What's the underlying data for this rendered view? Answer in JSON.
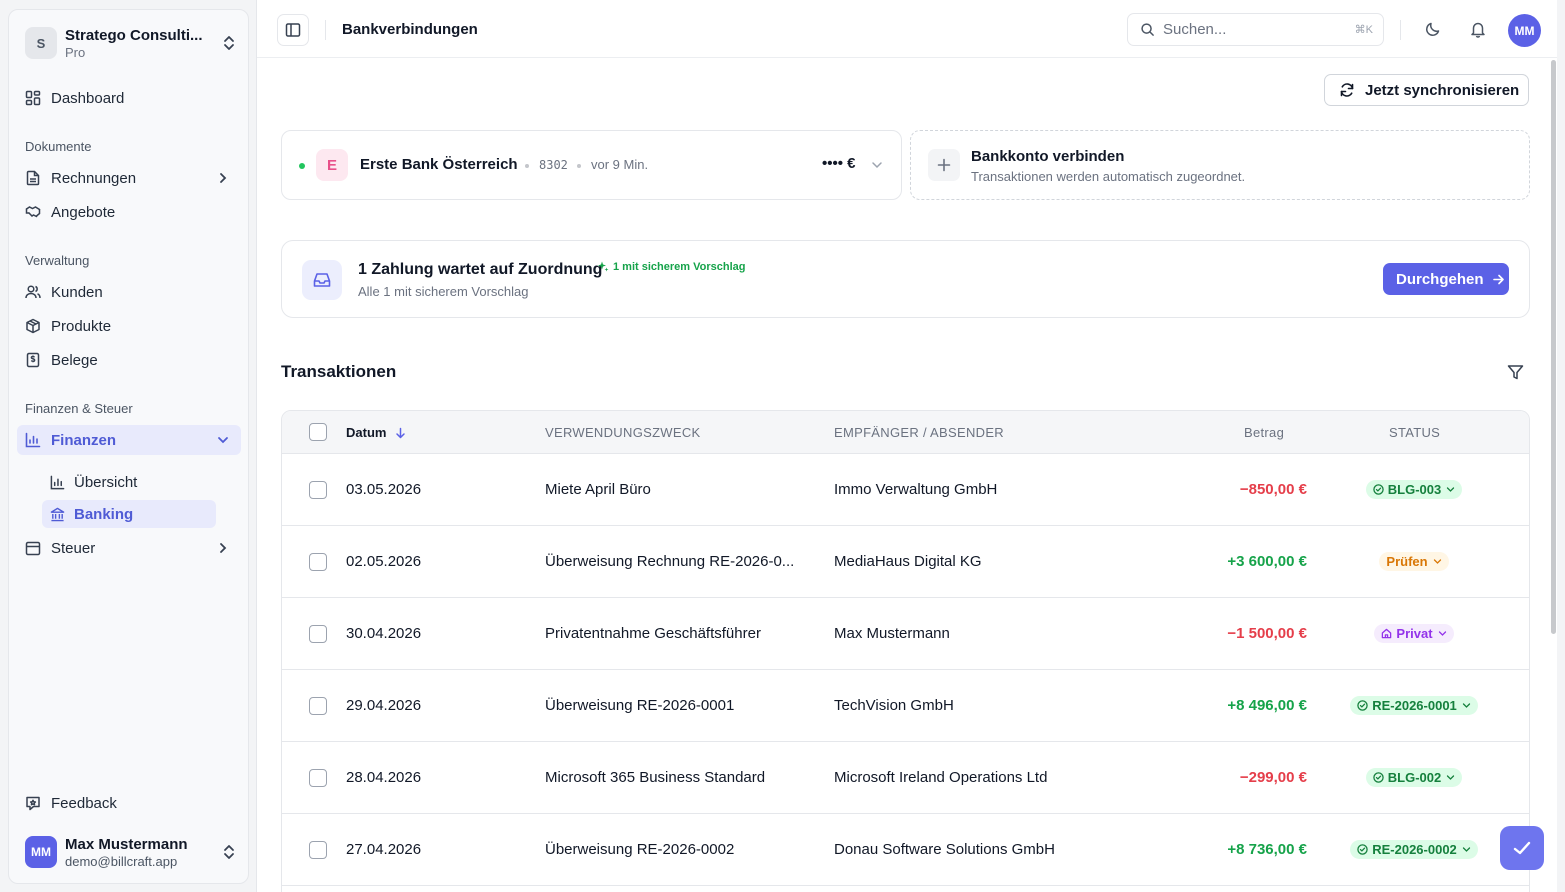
{
  "sidebar": {
    "org": {
      "initial": "S",
      "name": "Stratego Consulti...",
      "plan": "Pro"
    },
    "dashboard": "Dashboard",
    "sections": {
      "documents": "Dokumente",
      "admin": "Verwaltung",
      "finance": "Finanzen & Steuer"
    },
    "items": {
      "invoices": "Rechnungen",
      "offers": "Angebote",
      "customers": "Kunden",
      "products": "Produkte",
      "receipts": "Belege",
      "finance": "Finanzen",
      "overview": "Übersicht",
      "banking": "Banking",
      "tax": "Steuer"
    },
    "feedback": "Feedback",
    "user": {
      "initials": "MM",
      "name": "Max Mustermann",
      "email": "demo@billcraft.app"
    }
  },
  "header": {
    "title": "Bankverbindungen",
    "search_placeholder": "Suchen...",
    "shortcut": "⌘K",
    "avatar": "MM"
  },
  "sync_button": "Jetzt synchronisieren",
  "bank": {
    "initial": "E",
    "name": "Erste Bank Österreich",
    "account": "8302",
    "synced": "vor 9 Min.",
    "balance": "•••• €"
  },
  "connect": {
    "title": "Bankkonto verbinden",
    "subtitle": "Transaktionen werden automatisch zugeordnet."
  },
  "matching": {
    "title": "1 Zahlung wartet auf Zuordnung",
    "badge": "1 mit sicherem Vorschlag",
    "subtitle": "Alle 1 mit sicherem Vorschlag",
    "button": "Durchgehen"
  },
  "transactions": {
    "title": "Transaktionen",
    "columns": {
      "date": "Datum",
      "purpose": "VERWENDUNGSZWECK",
      "party": "EMPFÄNGER / ABSENDER",
      "amount": "Betrag",
      "status": "STATUS"
    },
    "rows": [
      {
        "date": "03.05.2026",
        "purpose": "Miete April Büro",
        "party": "Immo Verwaltung GmbH",
        "amount": "−850,00 €",
        "sign": "neg",
        "status": "BLG-003",
        "status_kind": "green"
      },
      {
        "date": "02.05.2026",
        "purpose": "Überweisung Rechnung RE-2026-0...",
        "party": "MediaHaus Digital KG",
        "amount": "+3 600,00 €",
        "sign": "pos",
        "status": "Prüfen",
        "status_kind": "amber"
      },
      {
        "date": "30.04.2026",
        "purpose": "Privatentnahme Geschäftsführer",
        "party": "Max Mustermann",
        "amount": "−1 500,00 €",
        "sign": "neg",
        "status": "Privat",
        "status_kind": "purple"
      },
      {
        "date": "29.04.2026",
        "purpose": "Überweisung RE-2026-0001",
        "party": "TechVision GmbH",
        "amount": "+8 496,00 €",
        "sign": "pos",
        "status": "RE-2026-0001",
        "status_kind": "green"
      },
      {
        "date": "28.04.2026",
        "purpose": "Microsoft 365 Business Standard",
        "party": "Microsoft Ireland Operations Ltd",
        "amount": "−299,00 €",
        "sign": "neg",
        "status": "BLG-002",
        "status_kind": "green"
      },
      {
        "date": "27.04.2026",
        "purpose": "Überweisung RE-2026-0002",
        "party": "Donau Software Solutions GmbH",
        "amount": "+8 736,00 €",
        "sign": "pos",
        "status": "RE-2026-0002",
        "status_kind": "green"
      }
    ]
  },
  "colors": {
    "accent": "#5b61e6",
    "positive": "#16a34a",
    "negative": "#e53e4a",
    "warning": "#d97706",
    "private": "#9333ea"
  }
}
